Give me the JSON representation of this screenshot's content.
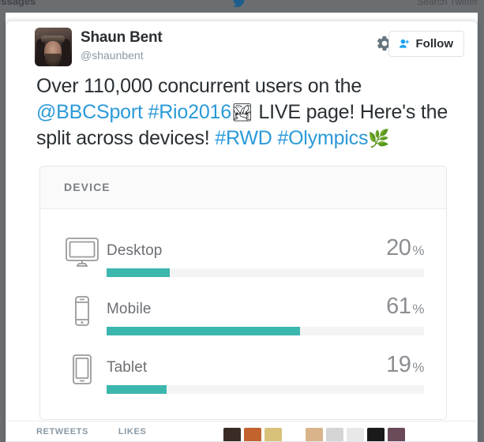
{
  "browser": {
    "nav_messages": "essages",
    "search_placeholder": "Search Twitter",
    "logo_icon": "twitter-bird-icon"
  },
  "tweet": {
    "author": {
      "display_name": "Shaun Bent",
      "handle": "@shaunbent",
      "avatar_icon": "user-avatar-photo"
    },
    "actions": {
      "settings_icon": "gear-icon",
      "follow_label": "Follow",
      "follow_icon": "person-plus-icon"
    },
    "text": {
      "line1_prefix": "Over 110,000 concurrent users on the",
      "mention_bbcsport": "@BBCSport",
      "hashtag_rio2016": "#Rio2016",
      "emoji_mountain": "🏞",
      "line2_middle": "LIVE page! Here's the",
      "line3_prefix": "split across devices!",
      "hashtag_rwd": "#RWD",
      "hashtag_olympics": "#Olympics",
      "emoji_wreath": "🌿"
    },
    "footer": {
      "retweets_label": "RETWEETS",
      "likes_label": "LIKES"
    }
  },
  "device_card": {
    "header": "DEVICE",
    "rows": [
      {
        "label": "Desktop",
        "value": 20,
        "value_text": "20",
        "unit": "%",
        "icon": "desktop-monitor-icon"
      },
      {
        "label": "Mobile",
        "value": 61,
        "value_text": "61",
        "unit": "%",
        "icon": "mobile-phone-icon"
      },
      {
        "label": "Tablet",
        "value": 19,
        "value_text": "19",
        "unit": "%",
        "icon": "tablet-icon"
      }
    ]
  },
  "chart_data": {
    "type": "bar",
    "title": "DEVICE",
    "categories": [
      "Desktop",
      "Mobile",
      "Tablet"
    ],
    "values": [
      20,
      61,
      19
    ],
    "unit": "%",
    "xlabel": "",
    "ylabel": "",
    "ylim": [
      0,
      100
    ],
    "orientation": "horizontal",
    "grid": false,
    "legend": false,
    "bar_color": "#3cb7ae",
    "track_color": "#f4f4f4"
  },
  "colors": {
    "accent_teal": "#3cb7ae",
    "link_blue": "#2b9ad8",
    "twitter_blue": "#1da1f2",
    "text_dark": "#292f33",
    "text_muted": "#8899a6"
  }
}
